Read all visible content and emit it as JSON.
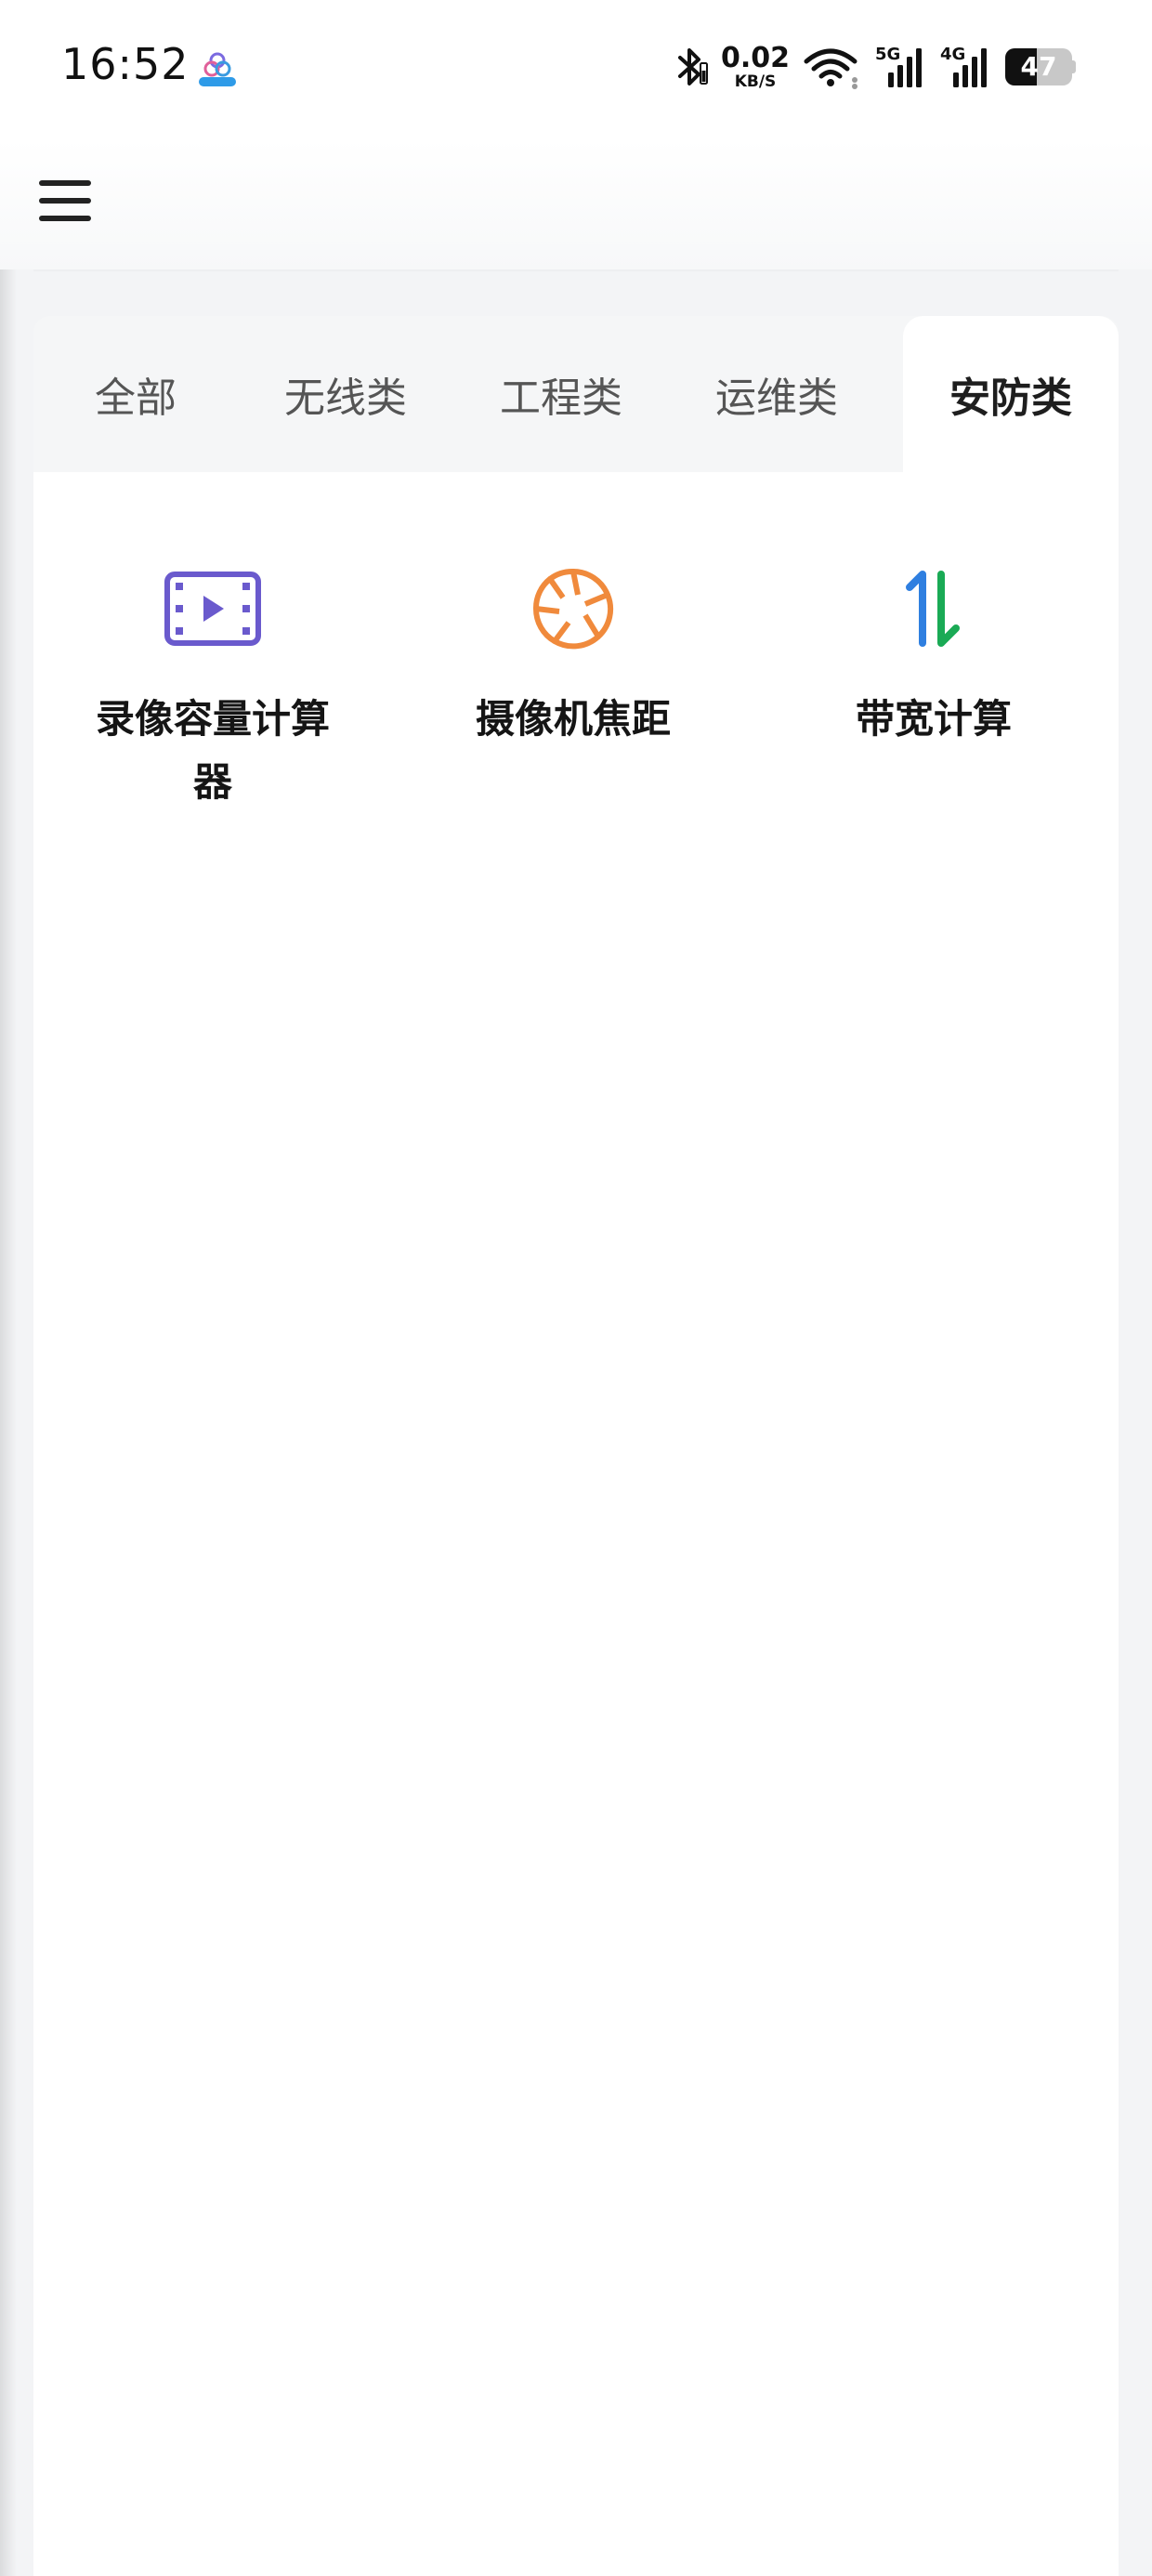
{
  "status_bar": {
    "time": "16:52",
    "network_speed_value": "0.02",
    "network_speed_unit": "KB/S",
    "signal_1_label": "5G",
    "signal_2_label": "4G",
    "battery_level": "47",
    "battery_fraction": 0.47,
    "icons": [
      "app-notification-icon",
      "bluetooth-icon",
      "wifi-icon",
      "signal-5g-icon",
      "signal-4g-icon",
      "battery-icon"
    ]
  },
  "header": {
    "menu_icon": "hamburger-menu-icon"
  },
  "tabs": [
    {
      "label": "全部",
      "active": false
    },
    {
      "label": "无线类",
      "active": false
    },
    {
      "label": "工程类",
      "active": false
    },
    {
      "label": "运维类",
      "active": false
    },
    {
      "label": "安防类",
      "active": true
    }
  ],
  "tools": [
    {
      "label": "录像容量计算器",
      "icon": "video-film-icon",
      "color": "#6a5acd"
    },
    {
      "label": "摄像机焦距",
      "icon": "camera-aperture-icon",
      "color": "#f08a3c"
    },
    {
      "label": "带宽计算",
      "icon": "up-down-arrows-icon",
      "colors": [
        "#2f7fe0",
        "#1aaa55"
      ]
    }
  ]
}
